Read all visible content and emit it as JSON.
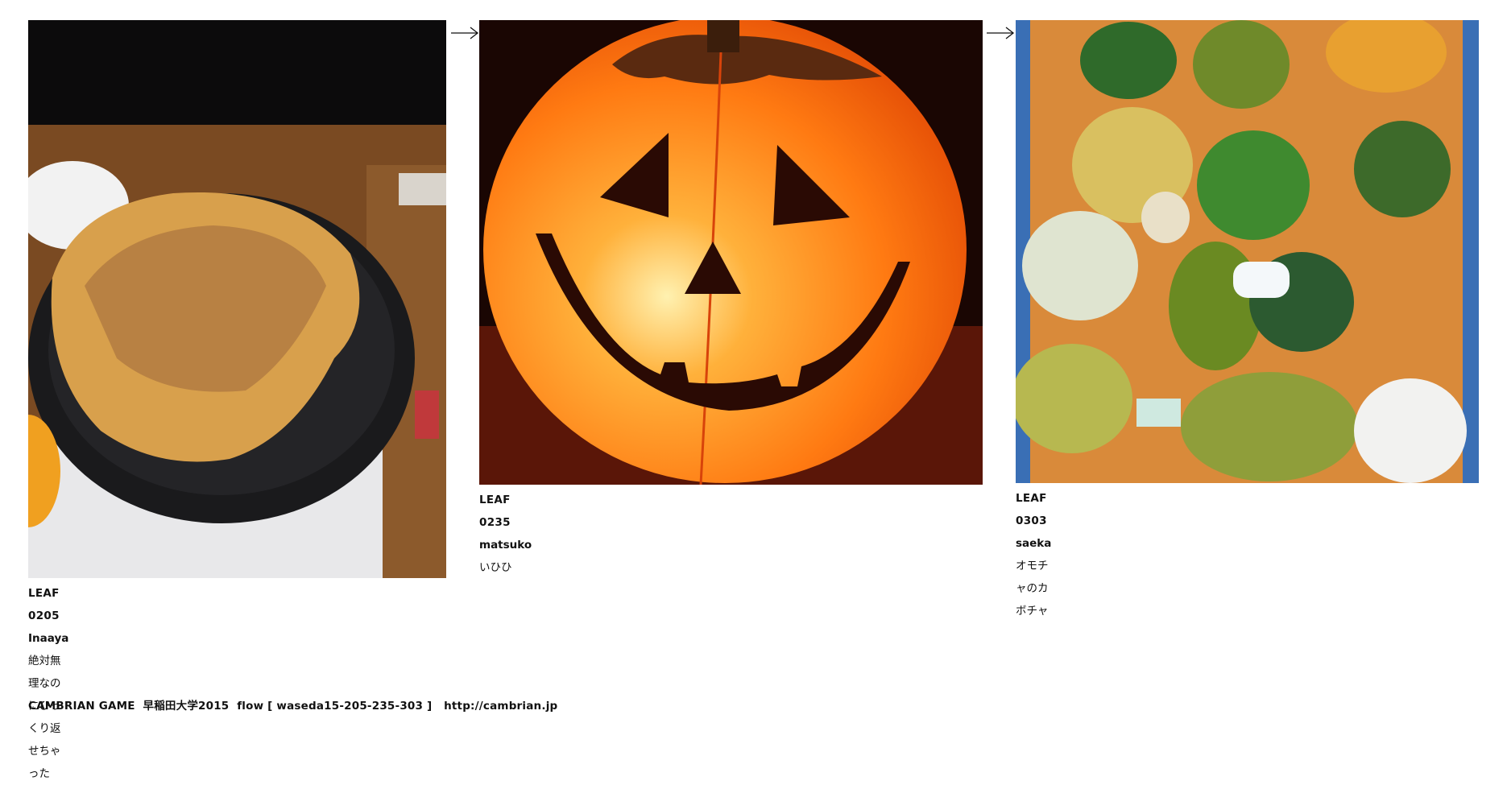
{
  "leaves": [
    {
      "code": "LEAF 0205",
      "author": "Inaaya",
      "caption": "絶対無理なのにひっくり返せちゃった",
      "image": "okonomiyaki-on-hotplate"
    },
    {
      "code": "LEAF 0235",
      "author": "matsuko",
      "caption": "いひひ",
      "image": "glowing-jack-o-lantern"
    },
    {
      "code": "LEAF 0303",
      "author": "saeka",
      "caption": "オモチャのカボチャ",
      "image": "ornamental-gourds-in-crate"
    }
  ],
  "arrows": {
    "icon": "right-arrow-icon"
  },
  "footer": {
    "text": "CAMBRIAN GAME  早稲田大学2015  flow [ waseda15-205-235-303 ]   ",
    "link": "http://cambrian.jp"
  }
}
